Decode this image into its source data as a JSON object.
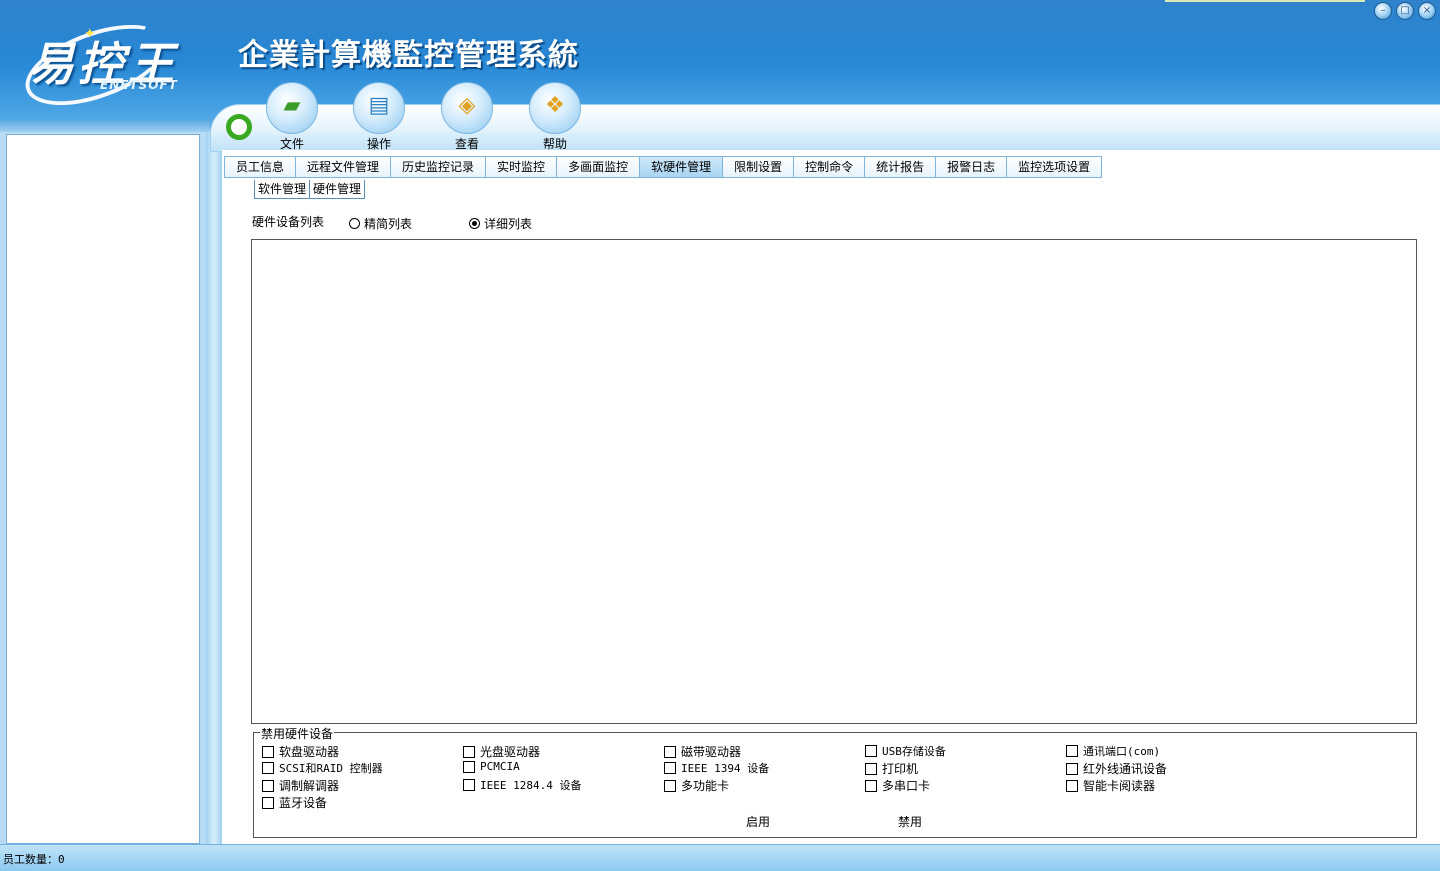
{
  "header": {
    "logo_text": "易控王",
    "logo_sub": "ENETSOFT",
    "app_title": "企業計算機監控管理系統"
  },
  "toolbar": {
    "buttons": [
      {
        "label": "文件",
        "icon": "folder-icon"
      },
      {
        "label": "操作",
        "icon": "document-icon"
      },
      {
        "label": "查看",
        "icon": "view-icon"
      },
      {
        "label": "帮助",
        "icon": "help-icon"
      }
    ]
  },
  "tabs": [
    {
      "label": "员工信息"
    },
    {
      "label": "远程文件管理"
    },
    {
      "label": "历史监控记录"
    },
    {
      "label": "实时监控"
    },
    {
      "label": "多画面监控"
    },
    {
      "label": "软硬件管理",
      "active": true
    },
    {
      "label": "限制设置"
    },
    {
      "label": "控制命令"
    },
    {
      "label": "统计报告"
    },
    {
      "label": "报警日志"
    },
    {
      "label": "监控选项设置"
    }
  ],
  "subtabs": [
    {
      "label": "软件管理"
    },
    {
      "label": "硬件管理",
      "active": true
    }
  ],
  "device_list": {
    "label": "硬件设备列表",
    "modes": [
      {
        "label": "精简列表",
        "selected": false
      },
      {
        "label": "详细列表",
        "selected": true
      }
    ]
  },
  "disable_group": {
    "title": "禁用硬件设备",
    "items": [
      {
        "label": "软盘驱动器",
        "checked": false
      },
      {
        "label": "光盘驱动器",
        "checked": false
      },
      {
        "label": "磁带驱动器",
        "checked": false
      },
      {
        "label": "USB存储设备",
        "checked": false
      },
      {
        "label": "通讯端口(com)",
        "checked": false
      },
      {
        "label": "SCSI和RAID 控制器",
        "checked": false
      },
      {
        "label": "PCMCIA",
        "checked": false
      },
      {
        "label": "IEEE 1394 设备",
        "checked": false
      },
      {
        "label": "打印机",
        "checked": false
      },
      {
        "label": "红外线通讯设备",
        "checked": false
      },
      {
        "label": "调制解调器",
        "checked": false
      },
      {
        "label": "IEEE 1284.4 设备",
        "checked": false
      },
      {
        "label": "多功能卡",
        "checked": false
      },
      {
        "label": "多串口卡",
        "checked": false
      },
      {
        "label": "智能卡阅读器",
        "checked": false
      },
      {
        "label": "蓝牙设备",
        "checked": false
      }
    ],
    "enable_label": "启用",
    "disable_label": "禁用"
  },
  "status": {
    "employee_count": "员工数量：0"
  },
  "colors": {
    "header_blue": "#2a8ad6",
    "panel_light_blue": "#b8dcf3",
    "tab_border": "#7fb4dc"
  }
}
